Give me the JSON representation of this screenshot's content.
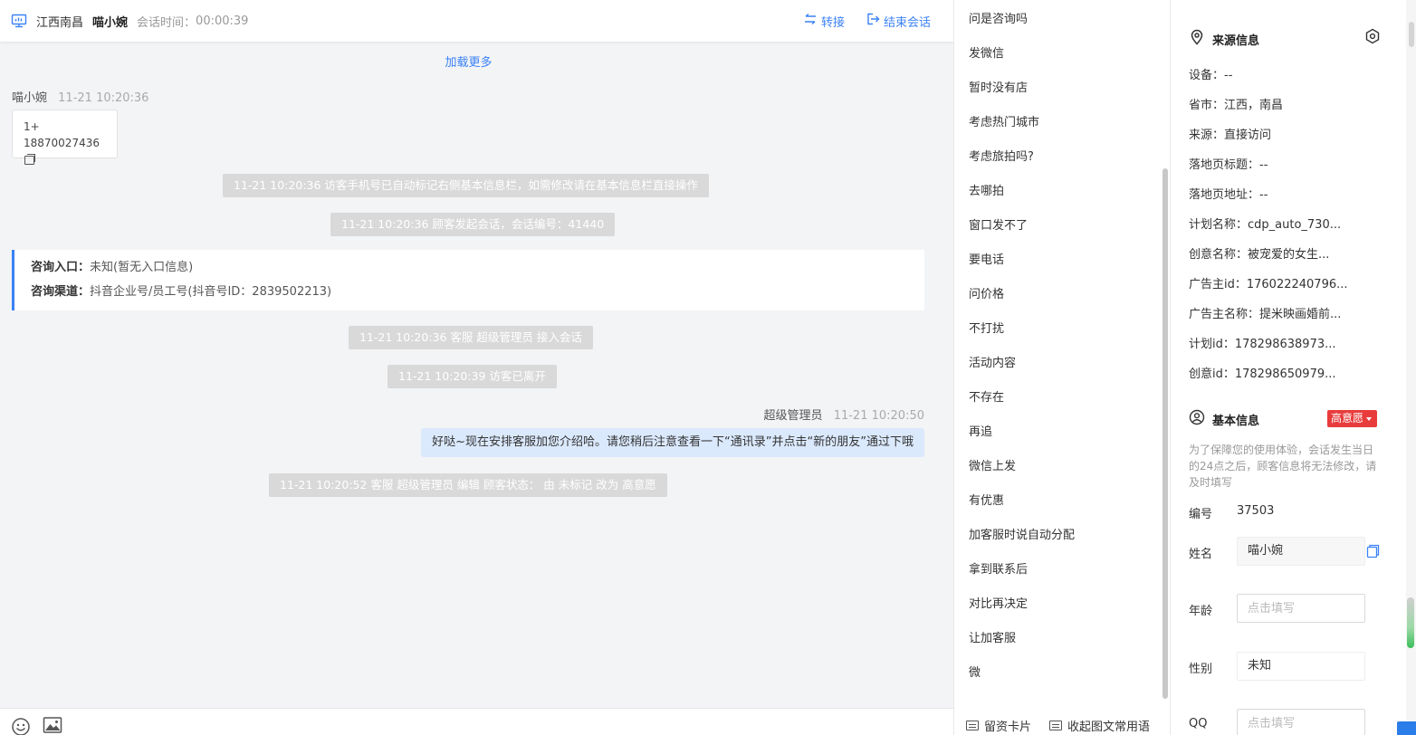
{
  "header": {
    "location": "江西南昌",
    "visitor_name": "喵小婉",
    "session_time_label": "会话时间：",
    "session_time": "00:00:39",
    "transfer_label": "转接",
    "end_label": "结束会话"
  },
  "chat": {
    "load_more": "加载更多",
    "visitor_msg": {
      "sender": "喵小婉",
      "time": "11-21 10:20:36",
      "line1": "1+",
      "line2": "18870027436"
    },
    "system_messages": [
      "11-21 10:20:36 访客手机号已自动标记右侧基本信息栏，如需修改请在基本信息栏直接操作",
      "11-21 10:20:36 顾客发起会话，会话编号：41440",
      "11-21 10:20:36 客服 超级管理员 接入会话",
      "11-21 10:20:39 访客已离开",
      "11-21 10:20:52 客服 超级管理员 编辑 顾客状态： 由 未标记 改为 高意愿"
    ],
    "entry": {
      "entry_key": "咨询入口：",
      "entry_val": "未知(暂无入口信息)",
      "channel_key": "咨询渠道：",
      "channel_val": "抖音企业号/员工号(抖音号ID：2839502213)"
    },
    "agent_msg": {
      "sender": "超级管理员",
      "time": "11-21 10:20:50",
      "text": "好哒~现在安排客服加您介绍哈。请您稍后注意查看一下“通讯录”并点击“新的朋友”通过下哦"
    }
  },
  "quick_replies": {
    "items": [
      "问是咨询吗",
      "发微信",
      "暂时没有店",
      "考虑热门城市",
      "考虑旅拍吗?",
      "去哪拍",
      "窗口发不了",
      "要电话",
      "问价格",
      "不打扰",
      "活动内容",
      "不存在",
      "再追",
      "微信上发",
      "有优惠",
      "加客服时说自动分配",
      "拿到联系后",
      "对比再决定",
      "让加客服",
      "微"
    ],
    "card_label": "留资卡片",
    "collapse_label": "收起图文常用语"
  },
  "source_info": {
    "title": "来源信息",
    "rows": [
      "设备：--",
      "省市：江西，南昌",
      "来源：直接访问",
      "落地页标题：--",
      "落地页地址：--",
      "计划名称：cdp_auto_730...",
      "创意名称：被宠爱的女生...",
      "广告主id：176022240796...",
      "广告主名称：提米映画婚前...",
      "计划id：178298638973...",
      "创意id：178298650979..."
    ]
  },
  "basic_info": {
    "title": "基本信息",
    "intent_badge": "高意愿",
    "notice": "为了保障您的使用体验，会话发生当日的24点之后，顾客信息将无法修改，请及时填写",
    "id_label": "编号",
    "id_value": "37503",
    "name_label": "姓名",
    "name_value": "喵小婉",
    "age_label": "年龄",
    "age_placeholder": "点击填写",
    "gender_label": "性别",
    "gender_value": "未知",
    "qq_label": "QQ",
    "qq_placeholder": "点击填写"
  },
  "colors": {
    "accent": "#3b82f6",
    "badge_red": "#e83c3c",
    "system_bg": "#d9d9d9",
    "agent_bubble": "#dbe9fd"
  }
}
